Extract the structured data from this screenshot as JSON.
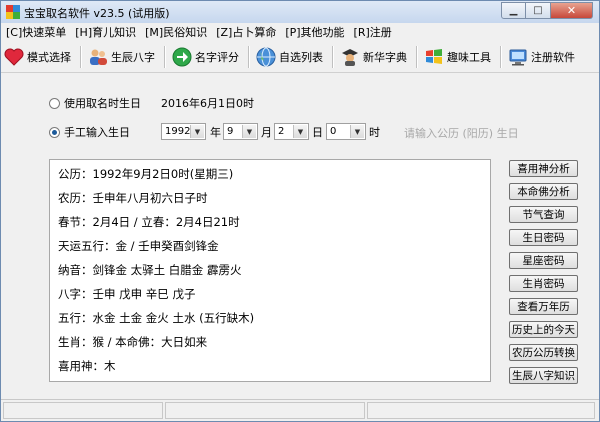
{
  "window": {
    "title": "宝宝取名软件 v23.5 (试用版)",
    "icon_name": "app-logo-icon"
  },
  "menu": [
    "[C]快速菜单",
    "[H]育儿知识",
    "[M]民俗知识",
    "[Z]占卜算命",
    "[P]其他功能",
    "[R]注册"
  ],
  "toolbar": [
    {
      "label": "模式选择",
      "icon": "heart-icon"
    },
    {
      "label": "生辰八字",
      "icon": "people-icon"
    },
    {
      "label": "名字评分",
      "icon": "green-arrow-icon"
    },
    {
      "label": "自选列表",
      "icon": "globe-icon"
    },
    {
      "label": "新华字典",
      "icon": "scholar-icon"
    },
    {
      "label": "趣味工具",
      "icon": "windows-flag-icon"
    },
    {
      "label": "注册软件",
      "icon": "computer-icon"
    }
  ],
  "birth": {
    "option1_label": "使用取名时生日",
    "option1_value": "2016年6月1日0时",
    "option2_label": "手工输入生日",
    "year": "1992",
    "year_unit": "年",
    "month": "9",
    "month_unit": "月",
    "day": "2",
    "day_unit": "日",
    "hour": "0",
    "hour_unit": "时",
    "hint": "请输入公历 (阳历) 生日"
  },
  "info_lines": [
    "公历：1992年9月2日0时(星期三)",
    "农历：壬申年八月初六日子时",
    "春节：2月4日 / 立春：2月4日21时",
    "天运五行：金 / 壬申癸酉剑锋金",
    "纳音：剑锋金 太驿土 白腊金 霹雳火",
    "八字：壬申 戊申 辛巳 戊子",
    "五行：水金 土金 金火 土水 (五行缺木)",
    "生肖：猴 / 本命佛：大日如来",
    "喜用神：木"
  ],
  "side_buttons": [
    "喜用神分析",
    "本命佛分析",
    "节气查询",
    "生日密码",
    "星座密码",
    "生肖密码",
    "查看万年历",
    "历史上的今天",
    "农历公历转换",
    "生辰八字知识"
  ],
  "colors": {
    "title_bg": "#c6d7ee",
    "close": "#c7483a",
    "hint": "#a8a8a8"
  }
}
